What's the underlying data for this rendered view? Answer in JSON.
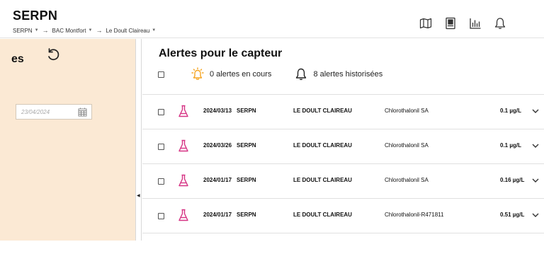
{
  "header": {
    "app_title": "SERPN",
    "breadcrumb": [
      {
        "label": "SERPN"
      },
      {
        "label": "BAC Montfort"
      },
      {
        "label": "Le Doult Claireau"
      }
    ],
    "icons": [
      "map-icon",
      "document-icon",
      "chart-icon",
      "bell-icon"
    ]
  },
  "left_panel": {
    "heading": "es",
    "date_placeholder": "23/04/2024",
    "background_color": "#fbe9d4"
  },
  "main": {
    "title": "Alertes pour le capteur",
    "summary": {
      "active_label": "0 alertes en cours",
      "history_label": "8 alertes historisées"
    },
    "accent_color": "#f5a623",
    "flask_color": "#d63384",
    "rows": [
      {
        "date": "2024/03/13",
        "source": "SERPN",
        "location": "LE DOULT CLAIREAU",
        "substance": "Chlorothalonil SA",
        "value": "0.1 µg/L"
      },
      {
        "date": "2024/03/26",
        "source": "SERPN",
        "location": "LE DOULT CLAIREAU",
        "substance": "Chlorothalonil SA",
        "value": "0.1 µg/L"
      },
      {
        "date": "2024/01/17",
        "source": "SERPN",
        "location": "LE DOULT CLAIREAU",
        "substance": "Chlorothalonil SA",
        "value": "0.16 µg/L"
      },
      {
        "date": "2024/01/17",
        "source": "SERPN",
        "location": "LE DOULT CLAIREAU",
        "substance": "Chlorothalonil-R471811",
        "value": "0.51 µg/L"
      }
    ]
  }
}
